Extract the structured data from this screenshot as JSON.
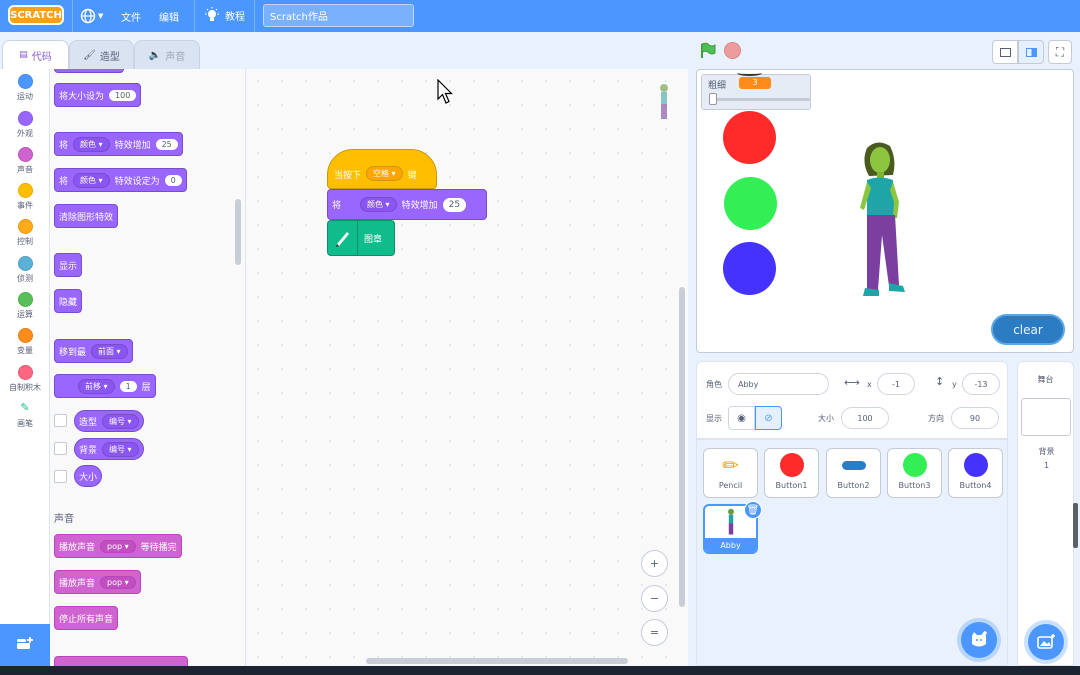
{
  "menubar": {
    "logo": "SCRATCH",
    "file": "文件",
    "edit": "编辑",
    "tutorials": "教程",
    "project_title": "Scratch作品"
  },
  "tabs": {
    "code": "代码",
    "costumes": "造型",
    "sounds": "声音"
  },
  "categories": [
    {
      "label": "运动",
      "color": "#4c97ff"
    },
    {
      "label": "外观",
      "color": "#9966ff"
    },
    {
      "label": "声音",
      "color": "#cf63cf"
    },
    {
      "label": "事件",
      "color": "#ffbf00"
    },
    {
      "label": "控制",
      "color": "#ffab19"
    },
    {
      "label": "侦测",
      "color": "#5cb1d6"
    },
    {
      "label": "运算",
      "color": "#59c059"
    },
    {
      "label": "变量",
      "color": "#ff8c1a"
    },
    {
      "label": "自制积木",
      "color": "#ff6680"
    },
    {
      "label": "画笔",
      "color": "#0fbd8c"
    }
  ],
  "palette": {
    "set_size": {
      "text": "将大小设为",
      "value": "100"
    },
    "change_effect": {
      "text1": "将",
      "effect": "颜色",
      "text2": "特效增加",
      "value": "25"
    },
    "set_effect": {
      "text1": "将",
      "effect": "颜色",
      "text2": "特效设定为",
      "value": "0"
    },
    "clear_effects": "清除图形特效",
    "show": "显示",
    "hide": "隐藏",
    "go_to_layer": {
      "text": "移到最",
      "option": "前面"
    },
    "go_layers": {
      "option": "前移",
      "value": "1",
      "text": "层"
    },
    "costume_rep": {
      "text": "造型",
      "option": "编号"
    },
    "backdrop_rep": {
      "text": "背景",
      "option": "编号"
    },
    "size_rep": "大小",
    "sound_header": "声音",
    "play_until": {
      "text": "播放声音",
      "sound": "pop",
      "text2": "等待播完"
    },
    "start_sound": {
      "text": "播放声音",
      "sound": "pop"
    },
    "stop_sounds": "停止所有声音"
  },
  "script": {
    "hat": {
      "text1": "当按下",
      "key": "空格",
      "text2": "键"
    },
    "effect": {
      "text1": "将",
      "effect": "颜色",
      "text2": "特效增加",
      "value": "25"
    },
    "pen": {
      "text": "图章"
    }
  },
  "zoom": {
    "in": "+",
    "out": "−",
    "reset": "="
  },
  "stage": {
    "monitor_label": "粗细",
    "monitor_value": "3",
    "slider_value_fraction": 0.03,
    "circles": [
      "#ff2a2a",
      "#33ee55",
      "#4433ff"
    ],
    "clear_button": "clear"
  },
  "sprite_info": {
    "sprite_label": "角色",
    "sprite_name": "Abby",
    "x_label": "x",
    "x": "-1",
    "y_label": "y",
    "y": "-13",
    "show_label": "显示",
    "size_label": "大小",
    "size": "100",
    "direction_label": "方向",
    "direction": "90"
  },
  "sprites": [
    {
      "name": "Pencil"
    },
    {
      "name": "Button1"
    },
    {
      "name": "Button2"
    },
    {
      "name": "Button3"
    },
    {
      "name": "Button4"
    },
    {
      "name": "Abby"
    }
  ],
  "stage_panel": {
    "title": "舞台",
    "backdrops_label": "背景",
    "backdrops_count": "1"
  }
}
